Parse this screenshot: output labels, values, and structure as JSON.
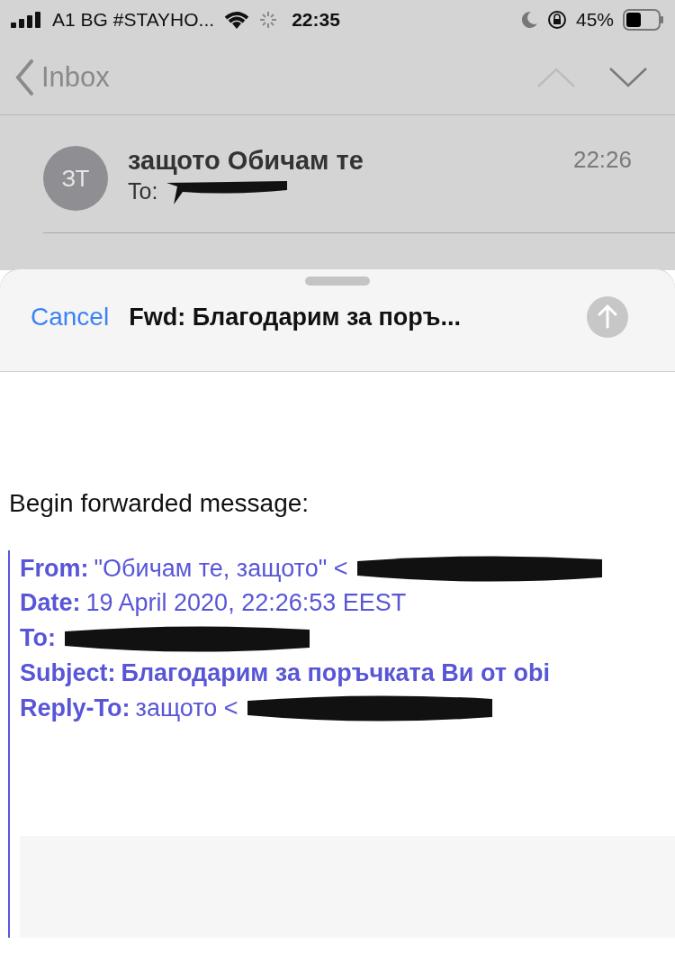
{
  "status_bar": {
    "carrier": "A1 BG #STAYHO...",
    "time": "22:35",
    "battery": "45%"
  },
  "nav": {
    "back": "Inbox"
  },
  "message": {
    "avatar": "ЗТ",
    "sender": "защото Обичам те",
    "time": "22:26",
    "to_label": "To:"
  },
  "compose": {
    "cancel": "Cancel",
    "subject": "Fwd: Благодарим за поръ..."
  },
  "body": {
    "intro": "Begin forwarded message:",
    "headers": [
      {
        "label": "From:",
        "value": "\"Обичам те, защото\" <",
        "bold_value": false,
        "redacted": true
      },
      {
        "label": "Date:",
        "value": "19 April 2020, 22:26:53 EEST",
        "bold_value": false,
        "redacted": false
      },
      {
        "label": "To:",
        "redacted": true
      },
      {
        "label": "Subject:",
        "value": "Благодарим за поръчката Ви от obi",
        "bold_value": true,
        "redacted": false
      },
      {
        "label": "Reply-To:",
        "value": "защото <",
        "bold_value": false,
        "redacted": true
      }
    ]
  }
}
